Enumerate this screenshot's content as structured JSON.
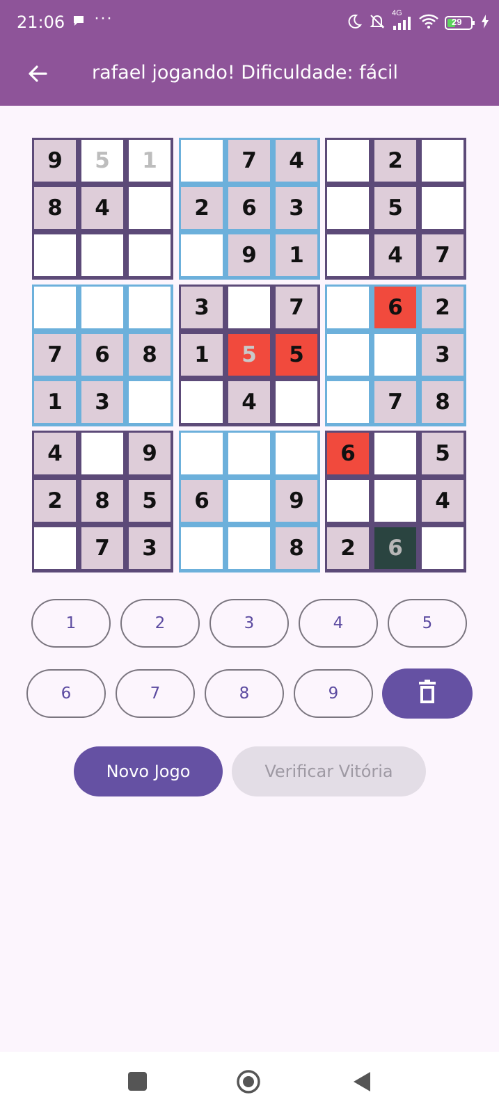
{
  "status_bar": {
    "time": "21:06",
    "dots": "···",
    "network": "4G",
    "battery": "29"
  },
  "app_bar": {
    "title": "rafael jogando! Dificuldade: fácil"
  },
  "board": {
    "rows": [
      [
        [
          "9",
          "given"
        ],
        [
          "5",
          "user"
        ],
        [
          "1",
          "user"
        ],
        [
          "",
          "empty"
        ],
        [
          "7",
          "given"
        ],
        [
          "4",
          "given"
        ],
        [
          "",
          "empty"
        ],
        [
          "2",
          "given"
        ],
        [
          "",
          "empty"
        ]
      ],
      [
        [
          "8",
          "given"
        ],
        [
          "4",
          "given"
        ],
        [
          "",
          "empty"
        ],
        [
          "2",
          "given"
        ],
        [
          "6",
          "given"
        ],
        [
          "3",
          "given"
        ],
        [
          "",
          "empty"
        ],
        [
          "5",
          "given"
        ],
        [
          "",
          "empty"
        ]
      ],
      [
        [
          "",
          "empty"
        ],
        [
          "",
          "empty"
        ],
        [
          "",
          "empty"
        ],
        [
          "",
          "empty"
        ],
        [
          "9",
          "given"
        ],
        [
          "1",
          "given"
        ],
        [
          "",
          "empty"
        ],
        [
          "4",
          "given"
        ],
        [
          "7",
          "given"
        ]
      ],
      [
        [
          "",
          "empty"
        ],
        [
          "",
          "empty"
        ],
        [
          "",
          "empty"
        ],
        [
          "3",
          "given"
        ],
        [
          "",
          "empty"
        ],
        [
          "7",
          "given"
        ],
        [
          "",
          "empty"
        ],
        [
          "6",
          "error"
        ],
        [
          "2",
          "given"
        ]
      ],
      [
        [
          "7",
          "given"
        ],
        [
          "6",
          "given"
        ],
        [
          "8",
          "given"
        ],
        [
          "1",
          "given"
        ],
        [
          "5",
          "error-user"
        ],
        [
          "5",
          "error"
        ],
        [
          "",
          "empty"
        ],
        [
          "",
          "empty"
        ],
        [
          "3",
          "given"
        ]
      ],
      [
        [
          "1",
          "given"
        ],
        [
          "3",
          "given"
        ],
        [
          "",
          "empty"
        ],
        [
          "",
          "empty"
        ],
        [
          "4",
          "given"
        ],
        [
          "",
          "empty"
        ],
        [
          "",
          "empty"
        ],
        [
          "7",
          "given"
        ],
        [
          "8",
          "given"
        ]
      ],
      [
        [
          "4",
          "given"
        ],
        [
          "",
          "empty"
        ],
        [
          "9",
          "given"
        ],
        [
          "",
          "empty"
        ],
        [
          "",
          "empty"
        ],
        [
          "",
          "empty"
        ],
        [
          "6",
          "error"
        ],
        [
          "",
          "empty"
        ],
        [
          "5",
          "given"
        ]
      ],
      [
        [
          "2",
          "given"
        ],
        [
          "8",
          "given"
        ],
        [
          "5",
          "given"
        ],
        [
          "6",
          "given"
        ],
        [
          "",
          "empty"
        ],
        [
          "9",
          "given"
        ],
        [
          "",
          "empty"
        ],
        [
          "",
          "empty"
        ],
        [
          "4",
          "given"
        ]
      ],
      [
        [
          "",
          "empty"
        ],
        [
          "7",
          "given"
        ],
        [
          "3",
          "given"
        ],
        [
          "",
          "empty"
        ],
        [
          "",
          "empty"
        ],
        [
          "8",
          "given"
        ],
        [
          "2",
          "given"
        ],
        [
          "6",
          "selected"
        ],
        [
          "",
          "empty"
        ]
      ]
    ]
  },
  "number_pad": {
    "row1": [
      "1",
      "2",
      "3",
      "4",
      "5"
    ],
    "row2": [
      "6",
      "7",
      "8",
      "9"
    ],
    "delete_icon": "trash-icon"
  },
  "actions": {
    "new_game": "Novo Jogo",
    "verify": "Verificar Vitória"
  },
  "colors": {
    "app_bar": "#8E5499",
    "block_dark": "#5C4A78",
    "block_blue": "#6CB0DB",
    "given_cell": "#DECDD9",
    "error_cell": "#F14A3D",
    "selected_cell": "#2A4440",
    "primary_button": "#6551A3"
  }
}
